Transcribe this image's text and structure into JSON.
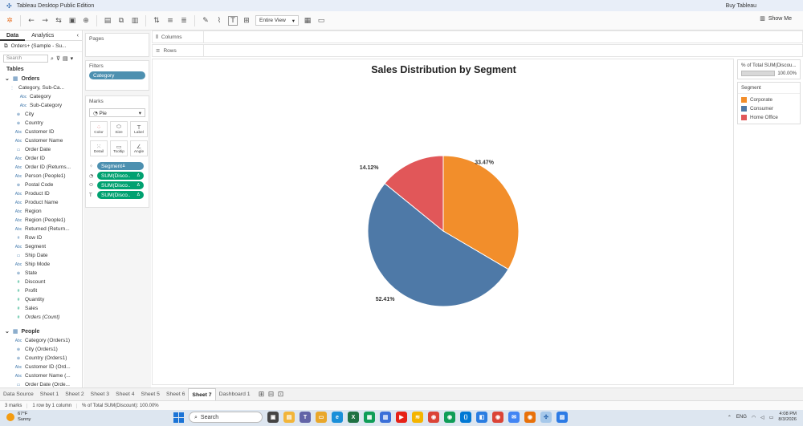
{
  "window": {
    "title": "Tableau Desktop Public Edition",
    "buy_label": "Buy Tableau"
  },
  "toolbar": {
    "view_select": "Entire View",
    "show_me": "Show Me"
  },
  "left_pane": {
    "tabs": [
      "Data",
      "Analytics"
    ],
    "datasource": "Orders+ (Sample - Su...",
    "search_placeholder": "Search",
    "tables_label": "Tables",
    "orders_table": "Orders",
    "orders_fields": [
      {
        "type": "hier",
        "name": "Category, Sub-Ca..."
      },
      {
        "type": "Abc",
        "name": "Category",
        "indent": true
      },
      {
        "type": "Abc",
        "name": "Sub-Category",
        "indent": true
      },
      {
        "type": "geo",
        "name": "City"
      },
      {
        "type": "geo",
        "name": "Country"
      },
      {
        "type": "Abc",
        "name": "Customer ID"
      },
      {
        "type": "Abc",
        "name": "Customer Name"
      },
      {
        "type": "date",
        "name": "Order Date"
      },
      {
        "type": "Abc",
        "name": "Order ID"
      },
      {
        "type": "Abc",
        "name": "Order ID (Returns..."
      },
      {
        "type": "Abc",
        "name": "Person (People1)"
      },
      {
        "type": "geo",
        "name": "Postal Code"
      },
      {
        "type": "Abc",
        "name": "Product ID"
      },
      {
        "type": "Abc",
        "name": "Product Name"
      },
      {
        "type": "Abc",
        "name": "Region"
      },
      {
        "type": "Abc",
        "name": "Region (People1)"
      },
      {
        "type": "Abc",
        "name": "Returned (Return..."
      },
      {
        "type": "num",
        "name": "Row ID"
      },
      {
        "type": "Abc",
        "name": "Segment"
      },
      {
        "type": "date",
        "name": "Ship Date"
      },
      {
        "type": "Abc",
        "name": "Ship Mode"
      },
      {
        "type": "geo",
        "name": "State"
      },
      {
        "type": "m",
        "name": "Discount"
      },
      {
        "type": "m",
        "name": "Profit"
      },
      {
        "type": "m",
        "name": "Quantity"
      },
      {
        "type": "m",
        "name": "Sales"
      },
      {
        "type": "m",
        "name": "Orders (Count)",
        "italic": true
      }
    ],
    "people_table": "People",
    "people_fields": [
      {
        "type": "Abc",
        "name": "Category (Orders1)"
      },
      {
        "type": "geo",
        "name": "City (Orders1)"
      },
      {
        "type": "geo",
        "name": "Country (Orders1)"
      },
      {
        "type": "Abc",
        "name": "Customer ID (Ord..."
      },
      {
        "type": "Abc",
        "name": "Customer Name (..."
      },
      {
        "type": "date",
        "name": "Order Date (Orde..."
      }
    ]
  },
  "cards": {
    "pages": "Pages",
    "filters": "Filters",
    "filter_pill": "Category",
    "marks": "Marks",
    "mark_type": "Pie",
    "mark_buttons": [
      "Color",
      "Size",
      "Label",
      "Detail",
      "Tooltip",
      "Angle"
    ],
    "mark_fields": [
      {
        "kind": "color",
        "label": "Segment",
        "dim": true
      },
      {
        "kind": "angle",
        "label": "SUM(Disco..",
        "dim": false
      },
      {
        "kind": "size",
        "label": "SUM(Disco..",
        "dim": false
      },
      {
        "kind": "label",
        "label": "SUM(Disco..",
        "dim": false
      }
    ]
  },
  "shelves": {
    "columns": "Columns",
    "rows": "Rows"
  },
  "chart_data": {
    "type": "pie",
    "title": "Sales Distribution by Segment",
    "categories": [
      "Corporate",
      "Consumer",
      "Home Office"
    ],
    "values": [
      33.47,
      52.41,
      14.12
    ],
    "labels": [
      "33.47%",
      "52.41%",
      "14.12%"
    ],
    "colors": [
      "#f28e2b",
      "#4e79a7",
      "#e15759"
    ],
    "legend_position": "right"
  },
  "legends": {
    "size_title": "% of Total SUM(Discou...",
    "size_value": "100.00%",
    "segment_title": "Segment",
    "items": [
      {
        "label": "Corporate",
        "color": "#f28e2b"
      },
      {
        "label": "Consumer",
        "color": "#4e79a7"
      },
      {
        "label": "Home Office",
        "color": "#e15759"
      }
    ]
  },
  "sheet_tabs": [
    "Data Source",
    "Sheet 1",
    "Sheet 2",
    "Sheet 3",
    "Sheet 4",
    "Sheet 5",
    "Sheet 6",
    "Sheet 7",
    "Dashboard 1"
  ],
  "active_sheet": "Sheet 7",
  "status": [
    "3 marks",
    "1 row by 1 column",
    "% of Total SUM(Discount): 100.00%"
  ],
  "taskbar": {
    "weather_temp": "67°F",
    "weather_desc": "Sunny",
    "search_label": "Search",
    "lang": "ENG",
    "time": "4:08 PM",
    "date": "8/3/2026"
  }
}
